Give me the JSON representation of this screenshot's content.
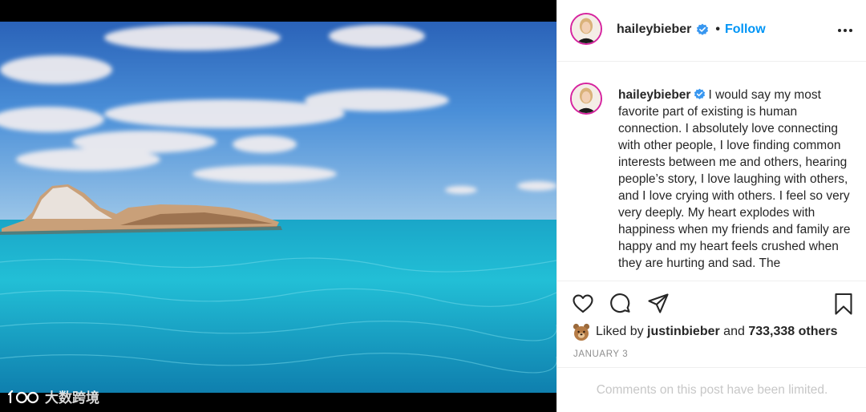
{
  "post": {
    "username": "haileybieber",
    "verified": true,
    "follow_label": "Follow",
    "dot": "•",
    "more_icon": "more-horizontal-icon"
  },
  "caption": {
    "username": "haileybieber",
    "text": "I would say my most favorite part of existing is human connection. I absolutely love connecting with other people, I love finding common interests between me and others, hearing people’s story, I love laughing with others, and I love crying with others. I feel so very very deeply. My heart explodes with happiness when my friends and family are happy and my heart feels crushed when they are hurting and sad. The"
  },
  "actions": {
    "like_icon": "heart-icon",
    "comment_icon": "comment-icon",
    "share_icon": "share-icon",
    "save_icon": "bookmark-icon"
  },
  "likes": {
    "prefix": "Liked by ",
    "liker": "justinbieber",
    "middle": " and ",
    "count": "733,338 others"
  },
  "date": "JANUARY 3",
  "comments_limited": "Comments on this post have been limited.",
  "watermark": {
    "text": "大数跨境"
  },
  "colors": {
    "accent": "#0095f6",
    "verified": "#3897f0",
    "muted": "#8e8e8e",
    "divider": "#efefef"
  }
}
